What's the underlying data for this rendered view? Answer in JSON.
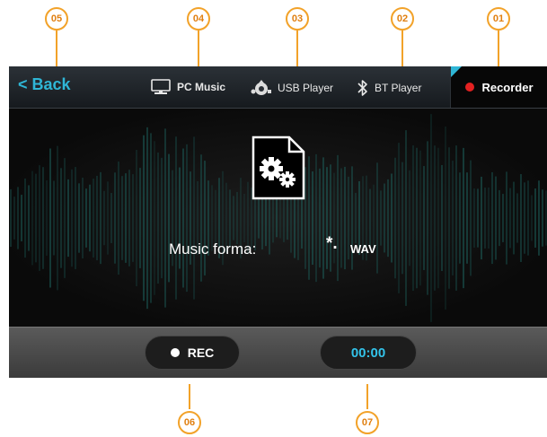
{
  "callouts": {
    "c01": "01",
    "c02": "02",
    "c03": "03",
    "c04": "04",
    "c05": "05",
    "c06": "06",
    "c07": "07"
  },
  "header": {
    "back_label": "< Back",
    "tabs": [
      {
        "label": "PC Music",
        "icon": "monitor-icon"
      },
      {
        "label": "USB Player",
        "icon": "usb-icon"
      },
      {
        "label": "BT Player",
        "icon": "bluetooth-icon"
      },
      {
        "label": "Recorder",
        "icon": "record-dot-icon",
        "active": true
      }
    ]
  },
  "main": {
    "icon": "file-settings-icon",
    "format_label": "Music forma:",
    "format_star": "*.",
    "format_value": "WAV"
  },
  "footer": {
    "rec_label": "REC",
    "timer": "00:00"
  },
  "colors": {
    "accent": "#2fb6d6",
    "callout": "#f2a229",
    "record_red": "#e32121"
  }
}
